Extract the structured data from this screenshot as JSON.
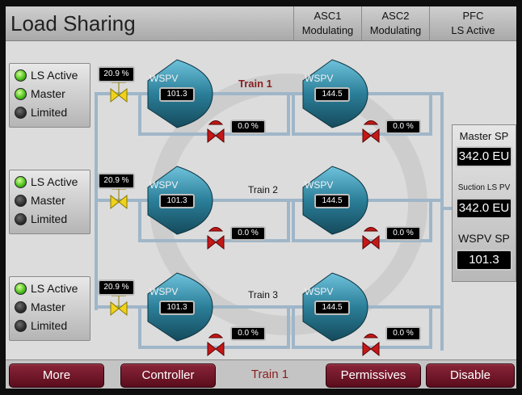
{
  "header": {
    "title": "Load Sharing",
    "status": [
      {
        "name": "ASC1",
        "state": "Modulating"
      },
      {
        "name": "ASC2",
        "state": "Modulating"
      },
      {
        "name": "PFC",
        "state": "LS Active"
      }
    ]
  },
  "status_panels": [
    {
      "items": [
        {
          "label": "LS Active",
          "on": true
        },
        {
          "label": "Master",
          "on": true
        },
        {
          "label": "Limited",
          "on": false
        }
      ]
    },
    {
      "items": [
        {
          "label": "LS Active",
          "on": true
        },
        {
          "label": "Master",
          "on": false
        },
        {
          "label": "Limited",
          "on": false
        }
      ]
    },
    {
      "items": [
        {
          "label": "LS Active",
          "on": true
        },
        {
          "label": "Master",
          "on": false
        },
        {
          "label": "Limited",
          "on": false
        }
      ]
    }
  ],
  "trains": [
    {
      "label": "Train 1",
      "inlet_valve": "20.9 %",
      "comp1": {
        "label": "WSPV",
        "value": "101.3"
      },
      "comp2": {
        "label": "WSPV",
        "value": "144.5"
      },
      "recycle1": "0.0 %",
      "recycle2": "0.0 %"
    },
    {
      "label": "Train 2",
      "inlet_valve": "20.9 %",
      "comp1": {
        "label": "WSPV",
        "value": "101.3"
      },
      "comp2": {
        "label": "WSPV",
        "value": "144.5"
      },
      "recycle1": "0.0 %",
      "recycle2": "0.0 %"
    },
    {
      "label": "Train 3",
      "inlet_valve": "20.9 %",
      "comp1": {
        "label": "WSPV",
        "value": "101.3"
      },
      "comp2": {
        "label": "WSPV",
        "value": "144.5"
      },
      "recycle1": "0.0 %",
      "recycle2": "0.0 %"
    }
  ],
  "right_panel": {
    "master_sp_label": "Master SP",
    "master_sp_value": "342.0 EU",
    "suction_label": "Suction LS PV",
    "suction_value": "342.0 EU",
    "wspv_sp_label": "WSPV SP",
    "wspv_sp_value": "101.3"
  },
  "footer": {
    "more": "More",
    "controller": "Controller",
    "selected_train": "Train 1",
    "permissives": "Permissives",
    "disable": "Disable"
  },
  "colors": {
    "compressor": "#2b7f99",
    "button": "#7a1a2e",
    "led_on": "#4fc21f",
    "inlet_valve": "#f0d21a",
    "recycle_valve": "#c41818"
  }
}
